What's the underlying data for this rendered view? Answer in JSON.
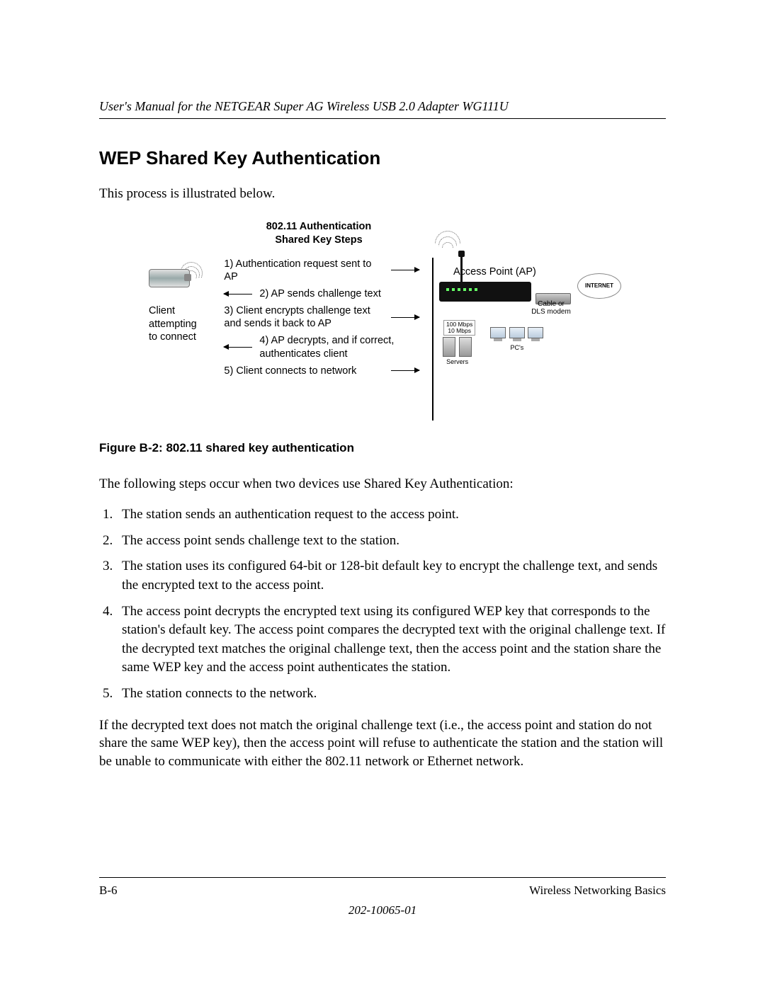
{
  "header": {
    "manual_title": "User's Manual for the NETGEAR Super AG Wireless USB 2.0 Adapter WG111U"
  },
  "section": {
    "heading": "WEP Shared Key Authentication",
    "intro": "This process is illustrated below."
  },
  "figure": {
    "title_line1": "802.11 Authentication",
    "title_line2": "Shared Key Steps",
    "client_label_l1": "Client",
    "client_label_l2": "attempting",
    "client_label_l3": "to connect",
    "ap_label": "Access Point (AP)",
    "modem_label": "Cable or DLS modem",
    "internet_label": "INTERNET",
    "speed_l1": "100 Mbps",
    "speed_l2": "10 Mbps",
    "servers_label": "Servers",
    "pcs_label": "PC's",
    "steps": [
      "1) Authentication request sent to AP",
      "2) AP sends challenge text",
      "3) Client encrypts challenge text and sends it back to AP",
      "4) AP decrypts, and if correct, authenticates client",
      "5) Client connects to network"
    ],
    "caption": "Figure B-2:  802.11 shared key authentication"
  },
  "body": {
    "lead": "The following steps occur when two devices use Shared Key Authentication:",
    "items": [
      "The station sends an authentication request to the access point.",
      "The access point sends challenge text to the station.",
      "The station uses its configured 64-bit or 128-bit default key to encrypt the challenge text, and sends the encrypted text to the access point.",
      "The access point decrypts the encrypted text using its configured WEP key that corresponds to the station's default key. The access point compares the decrypted text with the original challenge text. If the decrypted text matches the original challenge text, then the access point and the station share the same WEP key and the access point authenticates the station.",
      "The station connects to the network."
    ],
    "closing": "If the decrypted text does not match the original challenge text (i.e., the access point and station do not share the same WEP key), then the access point will refuse to authenticate the station and the station will be unable to communicate with either the 802.11 network or Ethernet network."
  },
  "footer": {
    "page_num": "B-6",
    "section_name": "Wireless Networking Basics",
    "doc_num": "202-10065-01"
  }
}
